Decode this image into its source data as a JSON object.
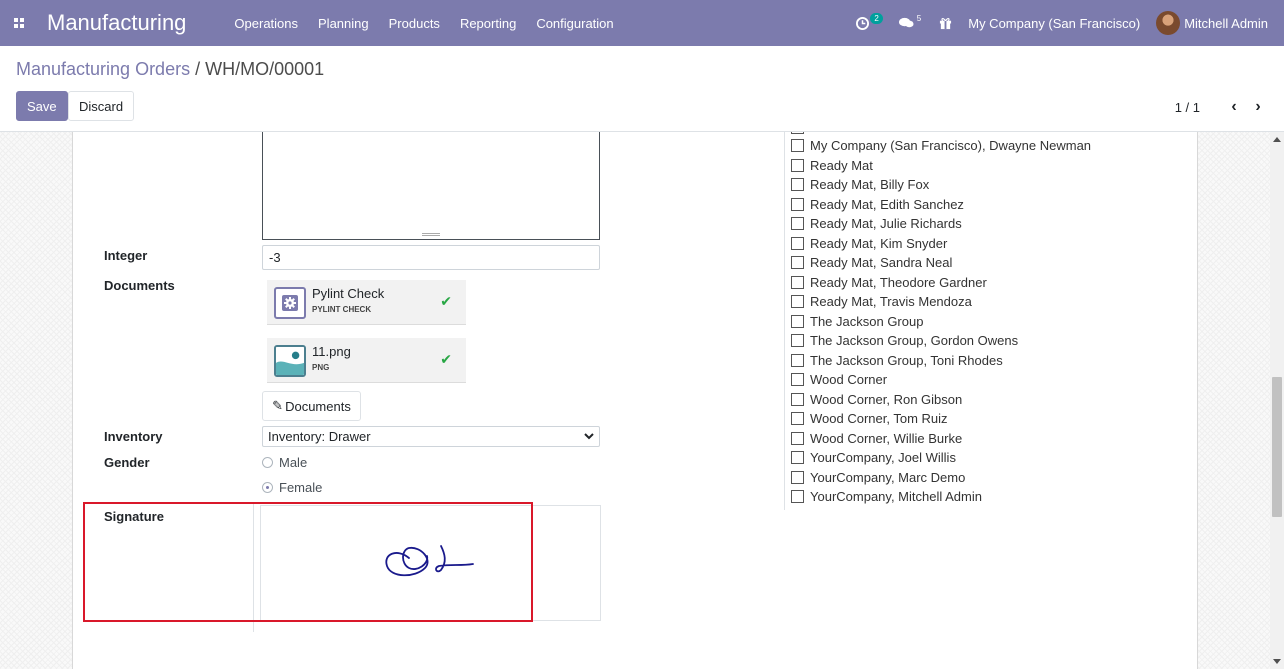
{
  "navbar": {
    "app_title": "Manufacturing",
    "menu": [
      "Operations",
      "Planning",
      "Products",
      "Reporting",
      "Configuration"
    ],
    "activity_count": "2",
    "messages_count": "5",
    "company": "My Company (San Francisco)",
    "user": "Mitchell Admin",
    "icons": [
      "apps-grid-icon",
      "clock-icon",
      "chat-icon",
      "gift-icon"
    ]
  },
  "control": {
    "breadcrumb_parent": "Manufacturing Orders",
    "breadcrumb_sep": "/",
    "breadcrumb_current": "WH/MO/00001",
    "save_label": "Save",
    "discard_label": "Discard",
    "pager_value": "1 / 1"
  },
  "form": {
    "integer_label": "Integer",
    "integer_value": "-3",
    "documents_label": "Documents",
    "documents": [
      {
        "name": "Pylint Check",
        "type": "PYLINT CHECK",
        "icon": "gear-icon"
      },
      {
        "name": "11.png",
        "type": "PNG",
        "icon": "image-icon"
      }
    ],
    "documents_button": "Documents",
    "inventory_label": "Inventory",
    "inventory_value": "Inventory: Drawer",
    "gender_label": "Gender",
    "gender_options": [
      "Male",
      "Female"
    ],
    "gender_selected": "Female",
    "signature_label": "Signature"
  },
  "right_list": {
    "items": [
      "My Company (San Francisco), Dwayne Newman",
      "Ready Mat",
      "Ready Mat, Billy Fox",
      "Ready Mat, Edith Sanchez",
      "Ready Mat, Julie Richards",
      "Ready Mat, Kim Snyder",
      "Ready Mat, Sandra Neal",
      "Ready Mat, Theodore Gardner",
      "Ready Mat, Travis Mendoza",
      "The Jackson Group",
      "The Jackson Group, Gordon Owens",
      "The Jackson Group, Toni Rhodes",
      "Wood Corner",
      "Wood Corner, Ron Gibson",
      "Wood Corner, Tom Ruiz",
      "Wood Corner, Willie Burke",
      "YourCompany, Joel Willis",
      "YourCompany, Marc Demo",
      "YourCompany, Mitchell Admin"
    ]
  },
  "colors": {
    "brand": "#7c7bad",
    "highlight": "#d9182a",
    "success": "#28a745"
  }
}
